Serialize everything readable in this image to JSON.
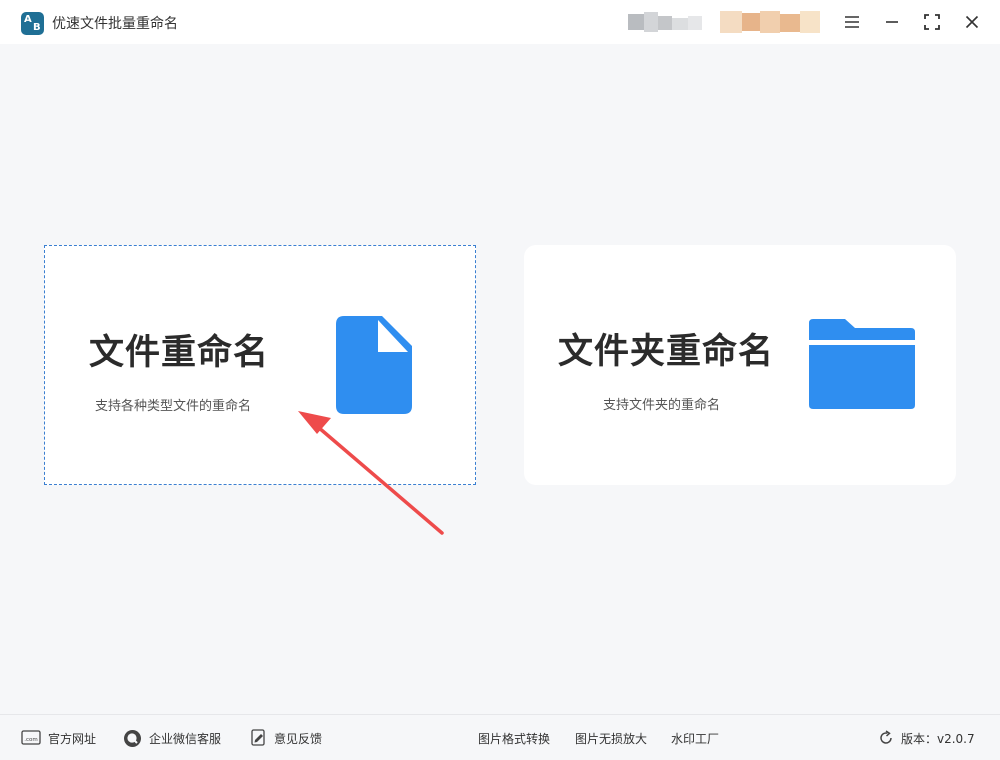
{
  "window": {
    "title": "优速文件批量重命名",
    "logo_letters": [
      "A",
      "B"
    ]
  },
  "cards": [
    {
      "title": "文件重命名",
      "description": "支持各种类型文件的重命名",
      "icon": "file-icon",
      "selected": true
    },
    {
      "title": "文件夹重命名",
      "description": "支持文件夹的重命名",
      "icon": "folder-icon",
      "selected": false
    }
  ],
  "footer": {
    "website": "官方网址",
    "wechat": "企业微信客服",
    "feedback": "意见反馈",
    "image_convert": "图片格式转换",
    "image_enlarge": "图片无损放大",
    "watermark": "水印工厂",
    "version_label": "版本：v2.0.7"
  },
  "colors": {
    "accent": "#2f8ef0",
    "logo": "#1f6f95",
    "annotation_arrow": "#ee4b4b"
  }
}
